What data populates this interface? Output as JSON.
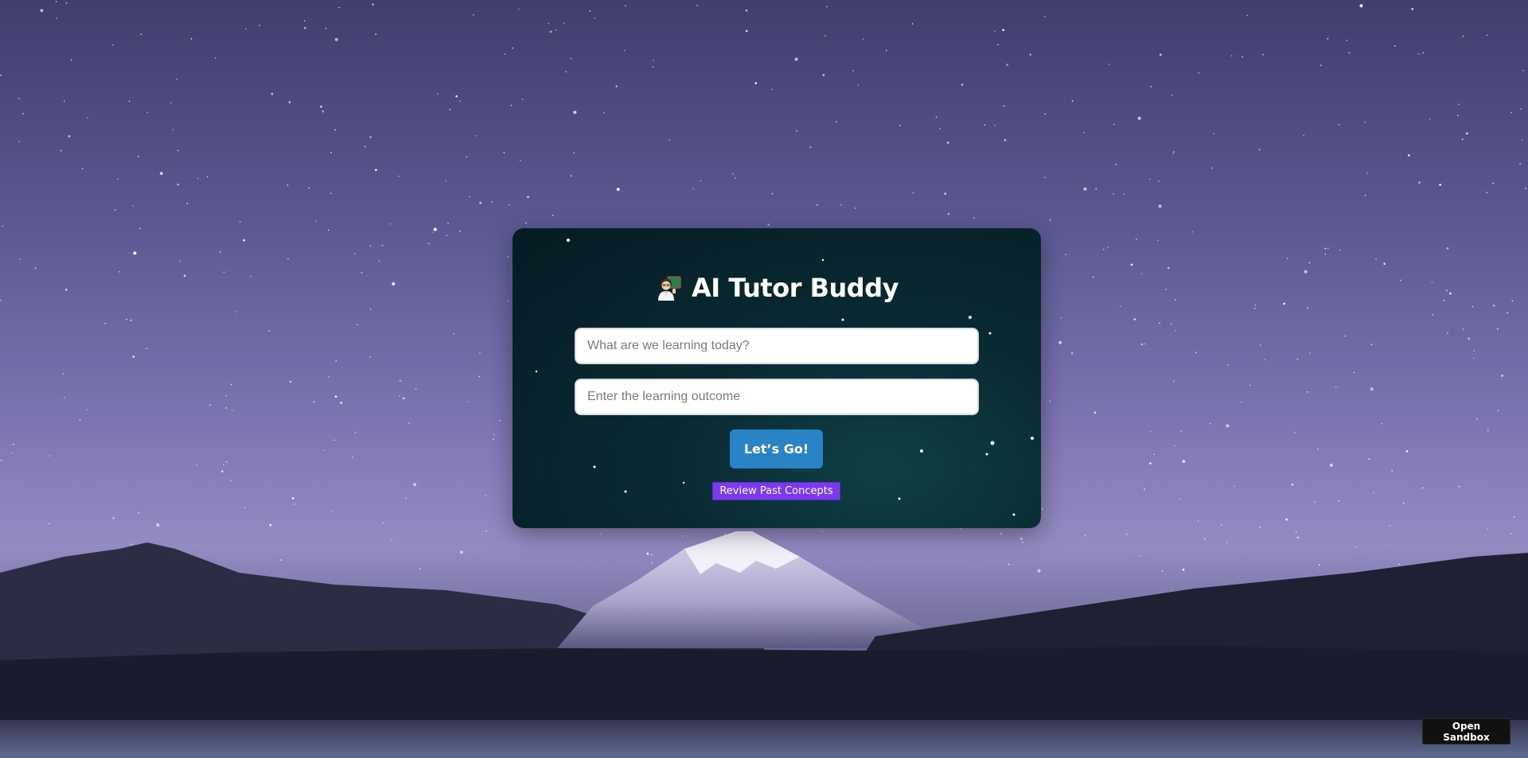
{
  "app": {
    "title": "AI Tutor Buddy",
    "title_icon": "teacher-emoji-icon"
  },
  "form": {
    "topic_placeholder": "What are we learning today?",
    "topic_value": "",
    "outcome_placeholder": "Enter the learning outcome",
    "outcome_value": "",
    "submit_label": "Let’s Go!",
    "review_label": "Review Past Concepts"
  },
  "footer": {
    "sandbox_label": "Open Sandbox"
  },
  "colors": {
    "submit_button": "#2a83c4",
    "review_button": "#7c3aed",
    "card_background": "#0a2a33",
    "sandbox_button": "#111111"
  }
}
